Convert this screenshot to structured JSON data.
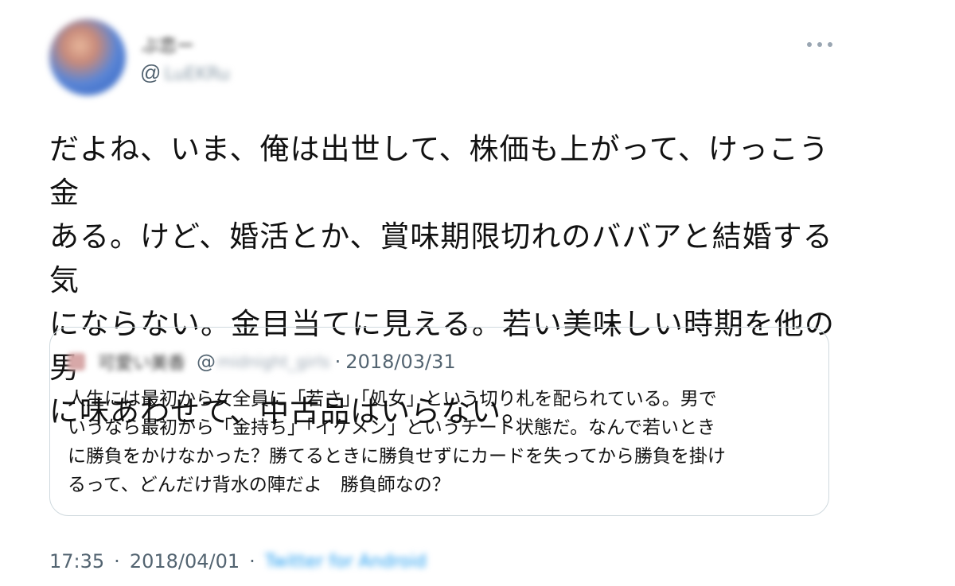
{
  "author": {
    "display_name": "ぶ恋ー",
    "handle_prefix": "@",
    "handle": "LuEKRu"
  },
  "more_icon": "more-horizontal-icon",
  "tweet": {
    "text": "だよね、いま、俺は出世して、株価も上がって、けっこう金\nある。けど、婚活とか、賞味期限切れのババアと結婚する気\nにならない。金目当てに見える。若い美味しい時期を他の男\nに味あわせて、中古品はいらない。"
  },
  "quote": {
    "name": "可愛い美香",
    "handle_prefix": "@",
    "handle": "midnight_girls",
    "separator": "·",
    "date": "2018/03/31",
    "text": "人生には最初から女全員に「若さ」「処女」という切り札を配られている。男で\nいうなら最初から「金持ち」「イケメン」というチート状態だ。なんで若いとき\nに勝負をかけなかった？勝てるときに勝負せずにカードを失ってから勝負を掛け\nるって、どんだけ背水の陣だよ　勝負師なの？"
  },
  "meta": {
    "time": "17:35",
    "separator": "·",
    "date": "2018/04/01",
    "client": "Twitter for Android"
  },
  "colors": {
    "text": "#0f1419",
    "secondary": "#536471",
    "border": "#cfd9de",
    "link": "#1d9bf0"
  }
}
